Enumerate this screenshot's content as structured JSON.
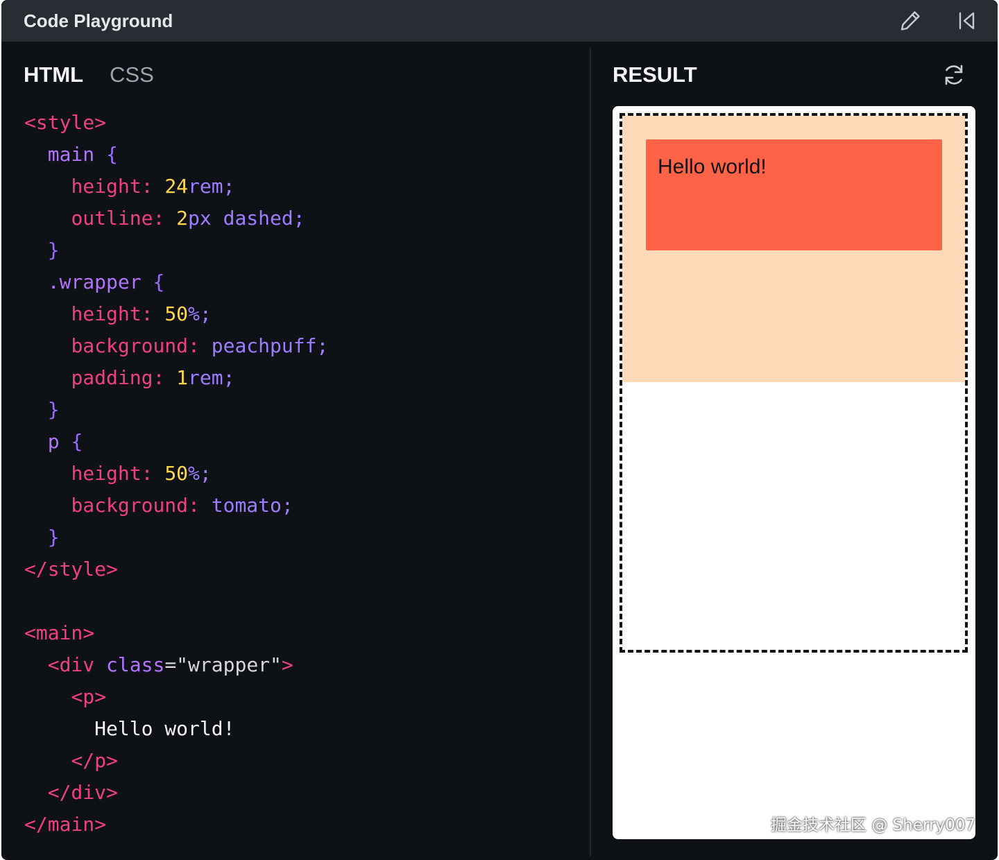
{
  "app": {
    "title": "Code Playground"
  },
  "toolbar": {
    "edit_icon": "pencil-icon",
    "collapse_icon": "skip-back-icon"
  },
  "editor": {
    "tabs": [
      {
        "label": "HTML",
        "active": true
      },
      {
        "label": "CSS",
        "active": false
      }
    ],
    "lines": [
      [
        {
          "t": "tag",
          "v": "<style>"
        }
      ],
      [
        {
          "t": "plain",
          "v": "  "
        },
        {
          "t": "sel",
          "v": "main"
        },
        {
          "t": "plain",
          "v": " "
        },
        {
          "t": "brace",
          "v": "{"
        }
      ],
      [
        {
          "t": "plain",
          "v": "    "
        },
        {
          "t": "prop",
          "v": "height:"
        },
        {
          "t": "plain",
          "v": " "
        },
        {
          "t": "num",
          "v": "24"
        },
        {
          "t": "val",
          "v": "rem;"
        }
      ],
      [
        {
          "t": "plain",
          "v": "    "
        },
        {
          "t": "prop",
          "v": "outline:"
        },
        {
          "t": "plain",
          "v": " "
        },
        {
          "t": "num",
          "v": "2"
        },
        {
          "t": "val",
          "v": "px dashed;"
        }
      ],
      [
        {
          "t": "plain",
          "v": "  "
        },
        {
          "t": "brace",
          "v": "}"
        }
      ],
      [
        {
          "t": "plain",
          "v": "  "
        },
        {
          "t": "sel",
          "v": ".wrapper"
        },
        {
          "t": "plain",
          "v": " "
        },
        {
          "t": "brace",
          "v": "{"
        }
      ],
      [
        {
          "t": "plain",
          "v": "    "
        },
        {
          "t": "prop",
          "v": "height:"
        },
        {
          "t": "plain",
          "v": " "
        },
        {
          "t": "num",
          "v": "50"
        },
        {
          "t": "val",
          "v": "%;"
        }
      ],
      [
        {
          "t": "plain",
          "v": "    "
        },
        {
          "t": "prop",
          "v": "background:"
        },
        {
          "t": "plain",
          "v": " "
        },
        {
          "t": "val",
          "v": "peachpuff;"
        }
      ],
      [
        {
          "t": "plain",
          "v": "    "
        },
        {
          "t": "prop",
          "v": "padding:"
        },
        {
          "t": "plain",
          "v": " "
        },
        {
          "t": "num",
          "v": "1"
        },
        {
          "t": "val",
          "v": "rem;"
        }
      ],
      [
        {
          "t": "plain",
          "v": "  "
        },
        {
          "t": "brace",
          "v": "}"
        }
      ],
      [
        {
          "t": "plain",
          "v": "  "
        },
        {
          "t": "sel",
          "v": "p"
        },
        {
          "t": "plain",
          "v": " "
        },
        {
          "t": "brace",
          "v": "{"
        }
      ],
      [
        {
          "t": "plain",
          "v": "    "
        },
        {
          "t": "prop",
          "v": "height:"
        },
        {
          "t": "plain",
          "v": " "
        },
        {
          "t": "num",
          "v": "50"
        },
        {
          "t": "val",
          "v": "%;"
        }
      ],
      [
        {
          "t": "plain",
          "v": "    "
        },
        {
          "t": "prop",
          "v": "background:"
        },
        {
          "t": "plain",
          "v": " "
        },
        {
          "t": "val",
          "v": "tomato;"
        }
      ],
      [
        {
          "t": "plain",
          "v": "  "
        },
        {
          "t": "brace",
          "v": "}"
        }
      ],
      [
        {
          "t": "tag",
          "v": "</style>"
        }
      ],
      [
        {
          "t": "plain",
          "v": ""
        }
      ],
      [
        {
          "t": "tag",
          "v": "<main>"
        }
      ],
      [
        {
          "t": "plain",
          "v": "  "
        },
        {
          "t": "tag",
          "v": "<div"
        },
        {
          "t": "plain",
          "v": " "
        },
        {
          "t": "attr",
          "v": "class"
        },
        {
          "t": "str",
          "v": "=\"wrapper\""
        },
        {
          "t": "tag",
          "v": ">"
        }
      ],
      [
        {
          "t": "plain",
          "v": "    "
        },
        {
          "t": "tag",
          "v": "<p>"
        }
      ],
      [
        {
          "t": "plain",
          "v": "      "
        },
        {
          "t": "text",
          "v": "Hello world!"
        }
      ],
      [
        {
          "t": "plain",
          "v": "    "
        },
        {
          "t": "tag",
          "v": "</p>"
        }
      ],
      [
        {
          "t": "plain",
          "v": "  "
        },
        {
          "t": "tag",
          "v": "</div>"
        }
      ],
      [
        {
          "t": "tag",
          "v": "</main>"
        }
      ]
    ]
  },
  "result": {
    "label": "RESULT",
    "refresh_icon": "refresh-icon",
    "preview_text": "Hello world!",
    "colors": {
      "wrapper_bg": "#ffdab9",
      "p_bg": "#ff6347"
    }
  },
  "watermark": "掘金技术社区 @ Sherry007"
}
